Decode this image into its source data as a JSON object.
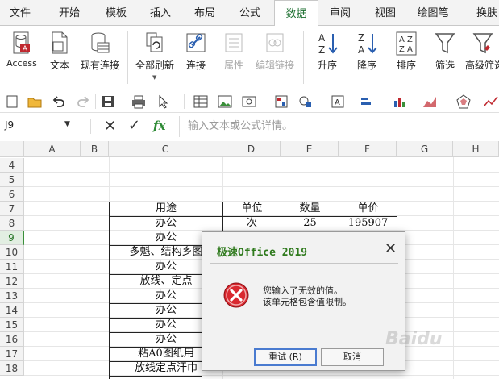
{
  "ribbon_tabs": [
    "文件",
    "开始",
    "模板",
    "插入",
    "布局",
    "公式",
    "数据",
    "审阅",
    "视图",
    "绘图笔",
    "换肤"
  ],
  "active_tab": "数据",
  "ribbon_buttons": {
    "access": "Access",
    "text": "文本",
    "existing_conn": "现有连接",
    "refresh_all": "全部刷新",
    "connections": "连接",
    "properties": "属性",
    "edit_links": "编辑链接",
    "sort_asc": "升序",
    "sort_desc": "降序",
    "sort": "排序",
    "filter": "筛选",
    "advanced_filter": "高级筛选"
  },
  "formula_bar": {
    "name_box": "J9",
    "fx": "fx",
    "placeholder": "输入文本或公式详情。"
  },
  "columns": [
    "A",
    "B",
    "C",
    "D",
    "E",
    "F",
    "G",
    "H"
  ],
  "rows": [
    "4",
    "5",
    "6",
    "7",
    "8",
    "9",
    "10",
    "11",
    "12",
    "13",
    "14",
    "15",
    "16",
    "17",
    "18"
  ],
  "selected_row": "9",
  "table": {
    "headers": [
      "用途",
      "单位",
      "数量",
      "单价"
    ],
    "row8": [
      "办公",
      "次",
      "25",
      "195907"
    ],
    "col_c": [
      "办公",
      "多魁、结构乡图",
      "办公",
      "放线、定点",
      "办公",
      "办公",
      "办公",
      "办公",
      "粘A0图纸用",
      "放线定点汗巾"
    ]
  },
  "dialog": {
    "title": "极速Office 2019",
    "message_line1": "您输入了无效的值。",
    "message_line2": "该单元格包含值限制。",
    "retry": "重试 (R)",
    "cancel": "取消",
    "close": "✕"
  },
  "colors": {
    "accent_green": "#2f7a1d",
    "error_red": "#d9282f",
    "selected_row_green": "#3a8f3a"
  },
  "watermark": "Baidu"
}
